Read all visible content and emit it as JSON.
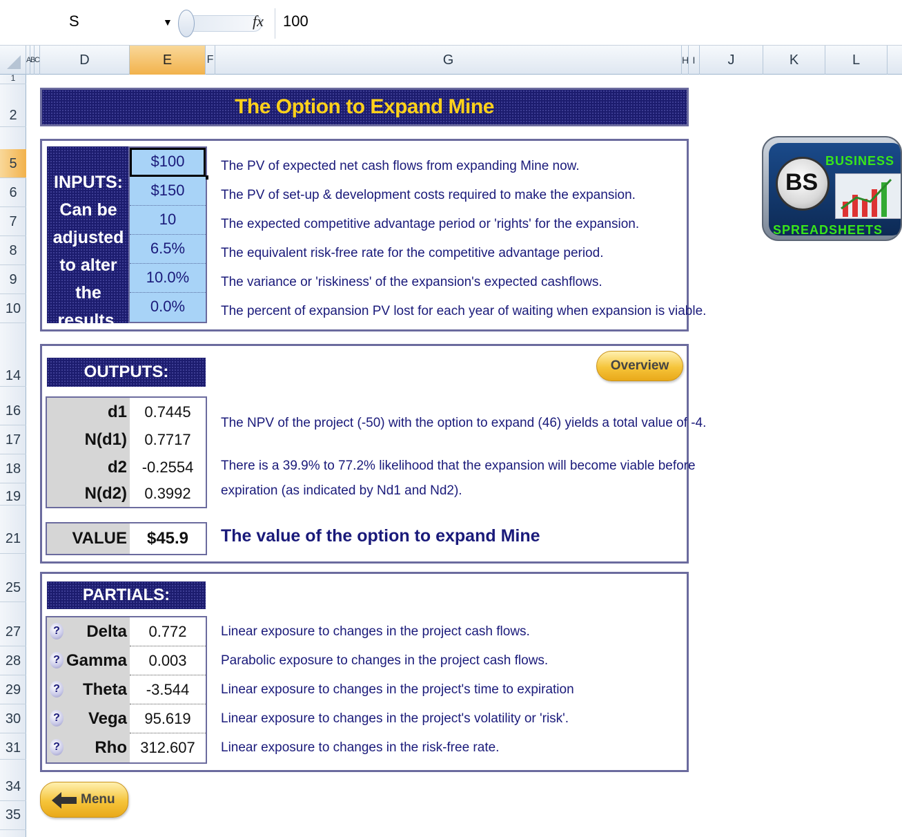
{
  "formula_bar": {
    "name_box": "S",
    "fx_label": "fx",
    "value": "100"
  },
  "columns": [
    "A",
    "B",
    "C",
    "D",
    "E",
    "F",
    "G",
    "H",
    "I",
    "J",
    "K",
    "L"
  ],
  "selected_column": "E",
  "rows": [
    "1",
    "2",
    "5",
    "6",
    "7",
    "8",
    "9",
    "10",
    "14",
    "16",
    "17",
    "18",
    "19",
    "21",
    "25",
    "27",
    "28",
    "29",
    "30",
    "31",
    "34",
    "35"
  ],
  "selected_row": "5",
  "title": "The Option to Expand Mine",
  "inputs": {
    "label": "INPUTS: Can be adjusted to alter the results.",
    "items": [
      {
        "value": "$100",
        "desc": "The PV of expected net cash flows from expanding Mine now."
      },
      {
        "value": "$150",
        "desc": "The PV of set-up & development costs required to make the expansion."
      },
      {
        "value": "10",
        "desc": "The expected competitive advantage period or 'rights' for the expansion."
      },
      {
        "value": "6.5%",
        "desc": "The equivalent risk-free rate for the competitive advantage period."
      },
      {
        "value": "10.0%",
        "desc": "The variance or 'riskiness' of the expansion's expected cashflows."
      },
      {
        "value": "0.0%",
        "desc": "The percent of expansion PV lost for each year of waiting when expansion is viable."
      }
    ]
  },
  "outputs": {
    "header": "OUTPUTS:",
    "overview_button": "Overview",
    "items": [
      {
        "label": "d1",
        "value": "0.7445"
      },
      {
        "label": "N(d1)",
        "value": "0.7717"
      },
      {
        "label": "d2",
        "value": "-0.2554"
      },
      {
        "label": "N(d2)",
        "value": "0.3992"
      }
    ],
    "npv_text": "The NPV of the project (-50) with the option to expand (46) yields a total value of -4.",
    "likelihood_text_1": "There is a 39.9% to 77.2% likelihood that the expansion will become viable before",
    "likelihood_text_2": "expiration (as indicated by Nd1 and Nd2).",
    "value_label": "VALUE",
    "value": "$45.9",
    "value_desc": "The value of the option to expand Mine"
  },
  "partials": {
    "header": "PARTIALS:",
    "help_glyph": "?",
    "items": [
      {
        "label": "Delta",
        "value": "0.772",
        "desc": "Linear exposure to changes in the project cash flows."
      },
      {
        "label": "Gamma",
        "value": "0.003",
        "desc": "Parabolic exposure to changes in the project cash flows."
      },
      {
        "label": "Theta",
        "value": "-3.544",
        "desc": "Linear exposure to changes in the project's time to expiration"
      },
      {
        "label": "Vega",
        "value": "95.619",
        "desc": "Linear exposure to changes in the project's volatility or 'risk'."
      },
      {
        "label": "Rho",
        "value": "312.607",
        "desc": "Linear exposure to changes in the risk-free rate."
      }
    ]
  },
  "menu_button": "Menu",
  "logo": {
    "top_text": "BUSINESS",
    "mark": "BS",
    "bottom_text": "SPREADSHEETS"
  }
}
